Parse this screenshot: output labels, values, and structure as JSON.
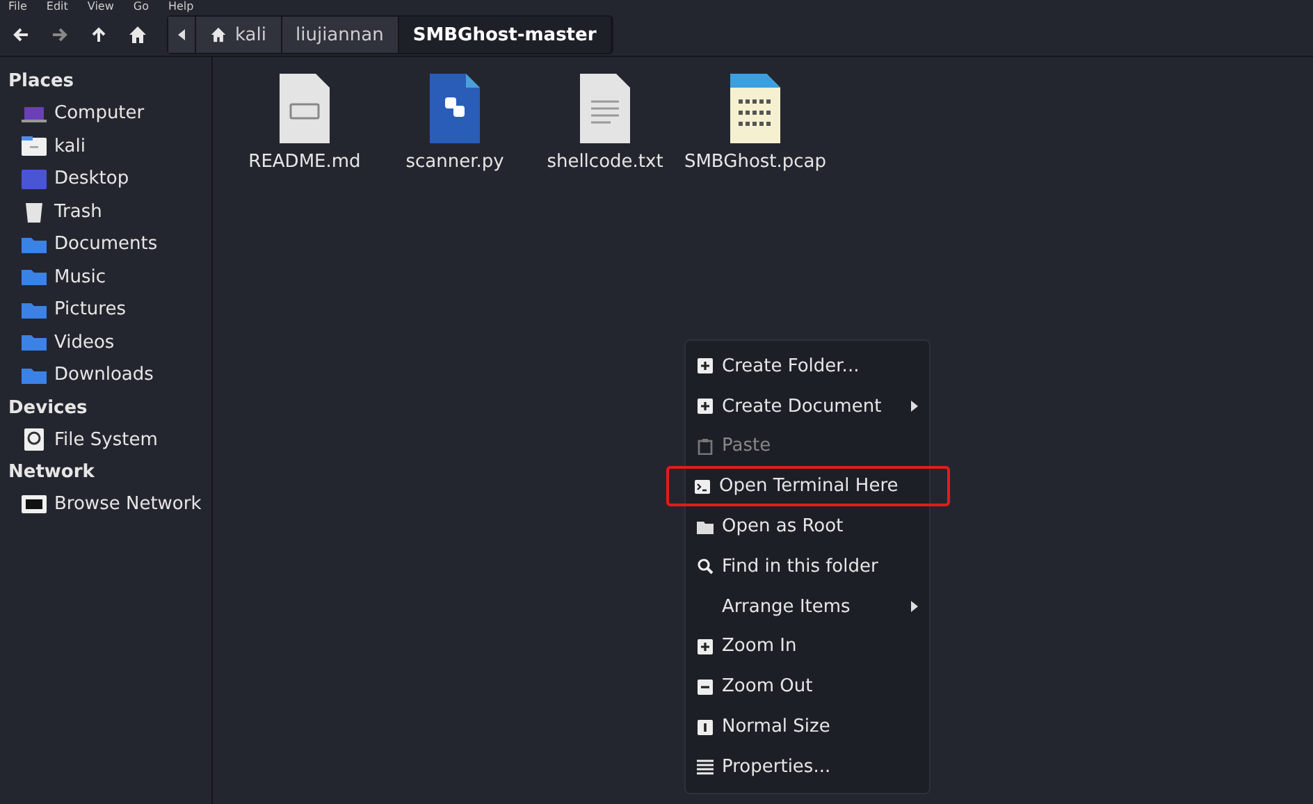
{
  "menu_bar": [
    "File",
    "Edit",
    "View",
    "Go",
    "Help"
  ],
  "toolbar": {
    "path": [
      {
        "label": "kali",
        "kind": "home",
        "selected": false
      },
      {
        "label": "liujiannan",
        "kind": "folder",
        "selected": false
      },
      {
        "label": "SMBGhost-master",
        "kind": "folder",
        "selected": true
      }
    ]
  },
  "sidebar": {
    "sections": [
      {
        "title": "Places",
        "items": [
          {
            "label": "Computer",
            "kind": "computer"
          },
          {
            "label": "kali",
            "kind": "home"
          },
          {
            "label": "Desktop",
            "kind": "desktop"
          },
          {
            "label": "Trash",
            "kind": "trash"
          },
          {
            "label": "Documents",
            "kind": "folder"
          },
          {
            "label": "Music",
            "kind": "folder"
          },
          {
            "label": "Pictures",
            "kind": "folder"
          },
          {
            "label": "Videos",
            "kind": "folder"
          },
          {
            "label": "Downloads",
            "kind": "folder"
          }
        ]
      },
      {
        "title": "Devices",
        "items": [
          {
            "label": "File System",
            "kind": "drive"
          }
        ]
      },
      {
        "title": "Network",
        "items": [
          {
            "label": "Browse Network",
            "kind": "network"
          }
        ]
      }
    ]
  },
  "files": [
    {
      "name": "README.md",
      "kind": "markdown"
    },
    {
      "name": "scanner.py",
      "kind": "python"
    },
    {
      "name": "shellcode.txt",
      "kind": "text"
    },
    {
      "name": "SMBGhost.pcap",
      "kind": "binary"
    }
  ],
  "context_menu": [
    {
      "label": "Create Folder...",
      "kind": "plus",
      "submenu": false,
      "disabled": false,
      "highlighted": false
    },
    {
      "label": "Create Document",
      "kind": "plus",
      "submenu": true,
      "disabled": false,
      "highlighted": false
    },
    {
      "label": "Paste",
      "kind": "clipboard",
      "submenu": false,
      "disabled": true,
      "highlighted": false
    },
    {
      "label": "Open Terminal Here",
      "kind": "terminal",
      "submenu": false,
      "disabled": false,
      "highlighted": true
    },
    {
      "label": "Open as Root",
      "kind": "folder",
      "submenu": false,
      "disabled": false,
      "highlighted": false
    },
    {
      "label": "Find in this folder",
      "kind": "search",
      "submenu": false,
      "disabled": false,
      "highlighted": false
    },
    {
      "label": "Arrange Items",
      "kind": "plain",
      "submenu": true,
      "disabled": false,
      "highlighted": false
    },
    {
      "label": "Zoom In",
      "kind": "plus",
      "submenu": false,
      "disabled": false,
      "highlighted": false
    },
    {
      "label": "Zoom Out",
      "kind": "minus",
      "submenu": false,
      "disabled": false,
      "highlighted": false
    },
    {
      "label": "Normal Size",
      "kind": "one",
      "submenu": false,
      "disabled": false,
      "highlighted": false
    },
    {
      "label": "Properties...",
      "kind": "lines",
      "submenu": false,
      "disabled": false,
      "highlighted": false
    }
  ]
}
